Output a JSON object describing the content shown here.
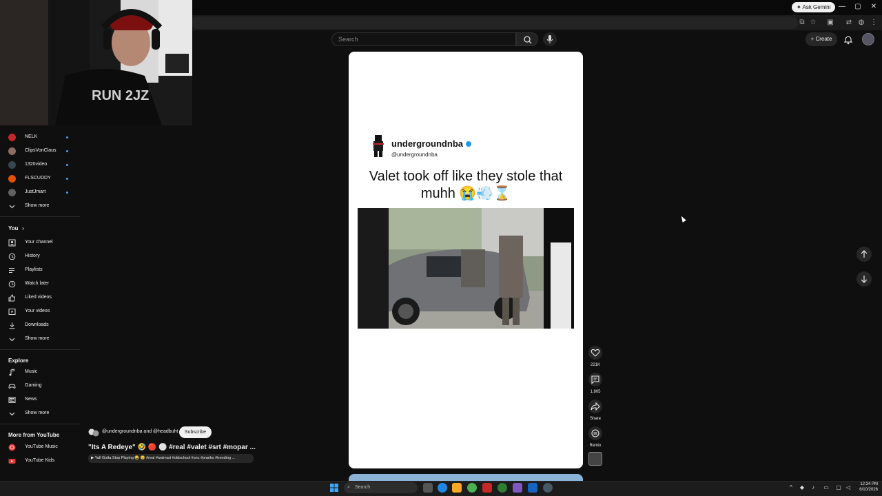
{
  "browser": {
    "ask_gemini": "Ask Gemini",
    "window_controls": [
      "—",
      "▢",
      "✕"
    ]
  },
  "header": {
    "search_placeholder": "Search",
    "create_label": "Create"
  },
  "sidebar": {
    "subscriptions": [
      {
        "name": "NELK",
        "color": "#c62828"
      },
      {
        "name": "ClipsVonClaus",
        "color": "#8d6e63"
      },
      {
        "name": "1320video",
        "color": "#37474f"
      },
      {
        "name": "FLSCUDDY",
        "color": "#e65100"
      },
      {
        "name": "JustJmart",
        "color": "#616161"
      }
    ],
    "subs_show_more": "Show more",
    "you_heading": "You",
    "you_items": [
      "Your channel",
      "History",
      "Playlists",
      "Watch later",
      "Liked videos",
      "Your videos",
      "Downloads"
    ],
    "you_show_more": "Show more",
    "explore_heading": "Explore",
    "explore_items": [
      "Music",
      "Gaming",
      "News"
    ],
    "explore_show_more": "Show more",
    "more_heading": "More from YouTube",
    "more_items": [
      "YouTube Music",
      "YouTube Kids"
    ]
  },
  "short": {
    "account_name": "undergroundnba",
    "account_handle": "@undergroundnba",
    "caption": "Valet took off like they stole that muhh 😭💨⌛"
  },
  "actions": {
    "like_count": "221K",
    "comment_count": "1,805",
    "share_label": "Share",
    "remix_label": "Remix"
  },
  "meta": {
    "channels": "@undergroundnba and @headbuht",
    "subscribe_label": "Subscribe",
    "title": "\"Its A Redeye\" 🤣 🔴 ⚪ #real #valet #srt #mopar ...",
    "music_pill": "▶ Yall Gotta Stop Playing 😂 😊 #real #walmart #oldschool #unc #pranks #trending ..."
  },
  "taskbar": {
    "search_placeholder": "Search",
    "time": "12:34 PM",
    "date": "6/10/2026"
  }
}
